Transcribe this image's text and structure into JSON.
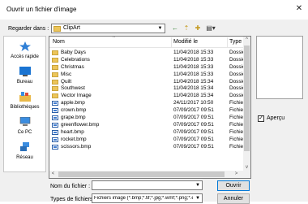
{
  "window": {
    "title": "Ouvrir un fichier d'image",
    "close_glyph": "✕"
  },
  "lookin": {
    "label": "Regarder dans :",
    "value": "ClipArt"
  },
  "toolbar": {
    "back_glyph": "←",
    "up_glyph": "⇡",
    "newfolder_glyph": "✚",
    "view_glyph": "▤▾"
  },
  "places": [
    {
      "label": "Accès rapide",
      "icon": "star-icon"
    },
    {
      "label": "Bureau",
      "icon": "desktop-icon"
    },
    {
      "label": "Bibliothèques",
      "icon": "libraries-icon"
    },
    {
      "label": "Ce PC",
      "icon": "computer-icon"
    },
    {
      "label": "Réseau",
      "icon": "network-icon"
    }
  ],
  "columns": {
    "name": "Nom",
    "modified": "Modifié le",
    "type": "Type",
    "sort_glyph": "^"
  },
  "files": [
    {
      "name": "Baby Days",
      "modified": "11/04/2018 15:33",
      "type": "Dossie",
      "kind": "folder"
    },
    {
      "name": "Celebrations",
      "modified": "11/04/2018 15:33",
      "type": "Dossie",
      "kind": "folder"
    },
    {
      "name": "Christmas",
      "modified": "11/04/2018 15:33",
      "type": "Dossie",
      "kind": "folder"
    },
    {
      "name": "Misc",
      "modified": "11/04/2018 15:33",
      "type": "Dossie",
      "kind": "folder"
    },
    {
      "name": "Quilt",
      "modified": "11/04/2018 15:34",
      "type": "Dossie",
      "kind": "folder"
    },
    {
      "name": "Southwest",
      "modified": "11/04/2018 15:34",
      "type": "Dossie",
      "kind": "folder"
    },
    {
      "name": "Vector Image",
      "modified": "11/04/2018 15:34",
      "type": "Dossie",
      "kind": "folder"
    },
    {
      "name": "apple.bmp",
      "modified": "24/11/2017 10:50",
      "type": "Fichier",
      "kind": "file"
    },
    {
      "name": "crown.bmp",
      "modified": "07/09/2017 09:51",
      "type": "Fichier",
      "kind": "file"
    },
    {
      "name": "grape.bmp",
      "modified": "07/09/2017 09:51",
      "type": "Fichier",
      "kind": "file"
    },
    {
      "name": "greenflower.bmp",
      "modified": "07/09/2017 09:51",
      "type": "Fichier",
      "kind": "file"
    },
    {
      "name": "heart.bmp",
      "modified": "07/09/2017 09:51",
      "type": "Fichier",
      "kind": "file"
    },
    {
      "name": "rocket.bmp",
      "modified": "07/09/2017 09:51",
      "type": "Fichier",
      "kind": "file"
    },
    {
      "name": "scissors.bmp",
      "modified": "07/09/2017 09:51",
      "type": "Fichier",
      "kind": "file"
    }
  ],
  "scroll": {
    "up": "^",
    "down": "v",
    "left": "<",
    "right": ">"
  },
  "preview": {
    "checkbox_label": "Aperçu",
    "checked": true,
    "check_glyph": "✓"
  },
  "filename": {
    "label": "Nom du fichier :",
    "value": ""
  },
  "filetype": {
    "label": "Types de fichiers :",
    "value": "Fichiers image (*.bmp;*.tif;*.jpg;*.wmf;*.png;*.eps;*.emf;*.gif)"
  },
  "buttons": {
    "open": "Ouvrir",
    "cancel": "Annuler"
  },
  "dropdown_glyph": "▼"
}
